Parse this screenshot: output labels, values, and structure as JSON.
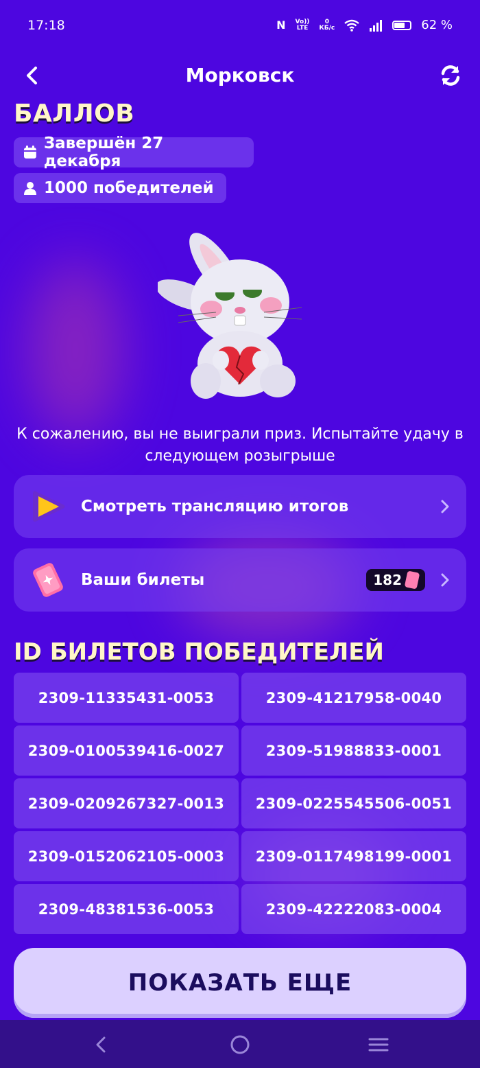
{
  "status_bar": {
    "time": "17:18",
    "nfc": "N",
    "volte_top": "Vo))",
    "volte_bottom": "LTE",
    "speed_top": "0",
    "speed_bottom": "КБ/с",
    "battery": "62 %"
  },
  "header": {
    "title": "Морковск",
    "back_icon": "chevron-left-icon",
    "refresh_icon": "refresh-icon"
  },
  "partial_title": "БАЛЛОВ",
  "chips": {
    "finished": "Завершён 27 декабря",
    "winners": "1000 победителей"
  },
  "message": "К сожалению, вы не выиграли приз. Испытайте удачу в следующем розыгрыше",
  "cards": {
    "broadcast_label": "Смотреть трансляцию итогов",
    "tickets_label": "Ваши билеты",
    "tickets_count": "182"
  },
  "winners_section": {
    "title": "ID БИЛЕТОВ ПОБЕДИТЕЛЕЙ",
    "ids": [
      "2309-11335431-0053",
      "2309-41217958-0040",
      "2309-0100539416-0027",
      "2309-51988833-0001",
      "2309-0209267327-0013",
      "2309-0225545506-0051",
      "2309-0152062105-0003",
      "2309-0117498199-0001",
      "2309-48381536-0053",
      "2309-42222083-0004"
    ]
  },
  "show_more": "ПОКАЗАТЬ ЕЩЕ",
  "colors": {
    "background": "#4d06e0",
    "title_yellow": "#fff6c8",
    "button_bg": "#dcd0ff",
    "button_text": "#1b0d5e"
  }
}
